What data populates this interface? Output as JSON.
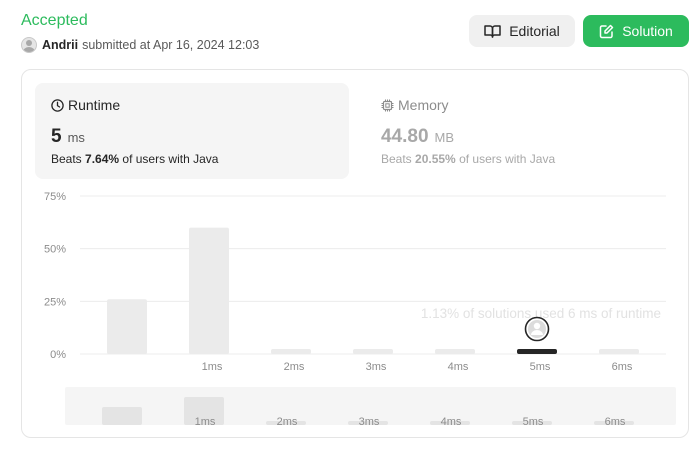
{
  "status": "Accepted",
  "submission": {
    "user": "Andrii",
    "text": "submitted at Apr 16, 2024 12:03"
  },
  "buttons": {
    "editorial": "Editorial",
    "solution": "Solution"
  },
  "icons": {
    "editorial": "book-open-icon",
    "solution": "edit-icon",
    "runtime": "clock-icon",
    "memory": "chip-icon",
    "marker": "user-avatar-icon"
  },
  "colors": {
    "accent": "#2cbb5d",
    "bar": "#ebebeb",
    "selected_bar": "#262626"
  },
  "runtime": {
    "title": "Runtime",
    "value": "5",
    "unit": "ms",
    "beats_prefix": "Beats",
    "beats_pct": "7.64%",
    "beats_suffix": "of users with Java"
  },
  "memory": {
    "title": "Memory",
    "value": "44.80",
    "unit": "MB",
    "beats_prefix": "Beats",
    "beats_pct": "20.55%",
    "beats_suffix": "of users with Java"
  },
  "chart_data": {
    "type": "bar",
    "categories": [
      "",
      "1ms",
      "2ms",
      "3ms",
      "4ms",
      "5ms",
      "6ms"
    ],
    "values": [
      26,
      60,
      1.5,
      1.5,
      1.5,
      1.13,
      1.5
    ],
    "selected_index": 5,
    "y_ticks": [
      "75%",
      "50%",
      "25%",
      "0%"
    ],
    "ylim": [
      0,
      75
    ],
    "tooltip": "1.13% of solutions used 6 ms of runtime",
    "grid": true
  },
  "overview": {
    "categories": [
      "",
      "1ms",
      "2ms",
      "3ms",
      "4ms",
      "5ms",
      "6ms"
    ],
    "values": [
      26,
      60,
      1.5,
      1.5,
      1.5,
      1.13,
      1.5
    ]
  }
}
